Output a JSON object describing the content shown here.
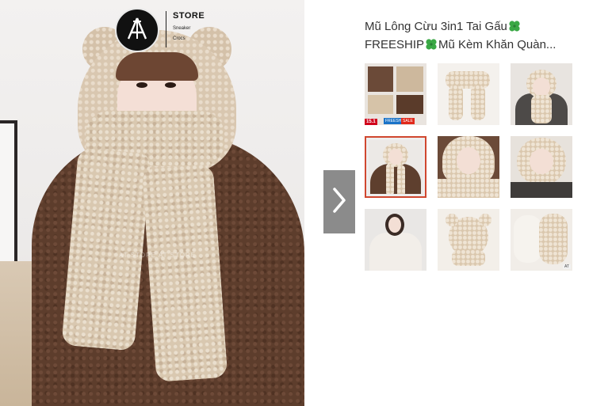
{
  "store": {
    "name": "STORE",
    "sub_lines": [
      "Sneaker",
      "Crocs"
    ],
    "watermark": "AT STORE      AT STORE"
  },
  "product": {
    "title_line1": "Mũ Lông Cừu 3in1 Tai Gấu",
    "title_line2_a": "FREESHIP",
    "title_line2_b": "Mũ Kèm Khăn Quàn..."
  },
  "gallery": {
    "selected_index": 3,
    "thumbnails": [
      {
        "name": "thumb-1",
        "badges": [
          "15.1",
          "FREESHIP",
          "SALE"
        ]
      },
      {
        "name": "thumb-2"
      },
      {
        "name": "thumb-3"
      },
      {
        "name": "thumb-4"
      },
      {
        "name": "thumb-5"
      },
      {
        "name": "thumb-6"
      },
      {
        "name": "thumb-7"
      },
      {
        "name": "thumb-8"
      },
      {
        "name": "thumb-9",
        "tag": "AT"
      }
    ]
  },
  "icons": {
    "next": "chevron-right-icon",
    "clover": "clover-icon",
    "logo": "at-logo-icon"
  },
  "colors": {
    "selected_border": "#d0472f",
    "arrow_bg": "#8b8b8b",
    "title_text": "#333333",
    "clover": "#3aa845"
  }
}
